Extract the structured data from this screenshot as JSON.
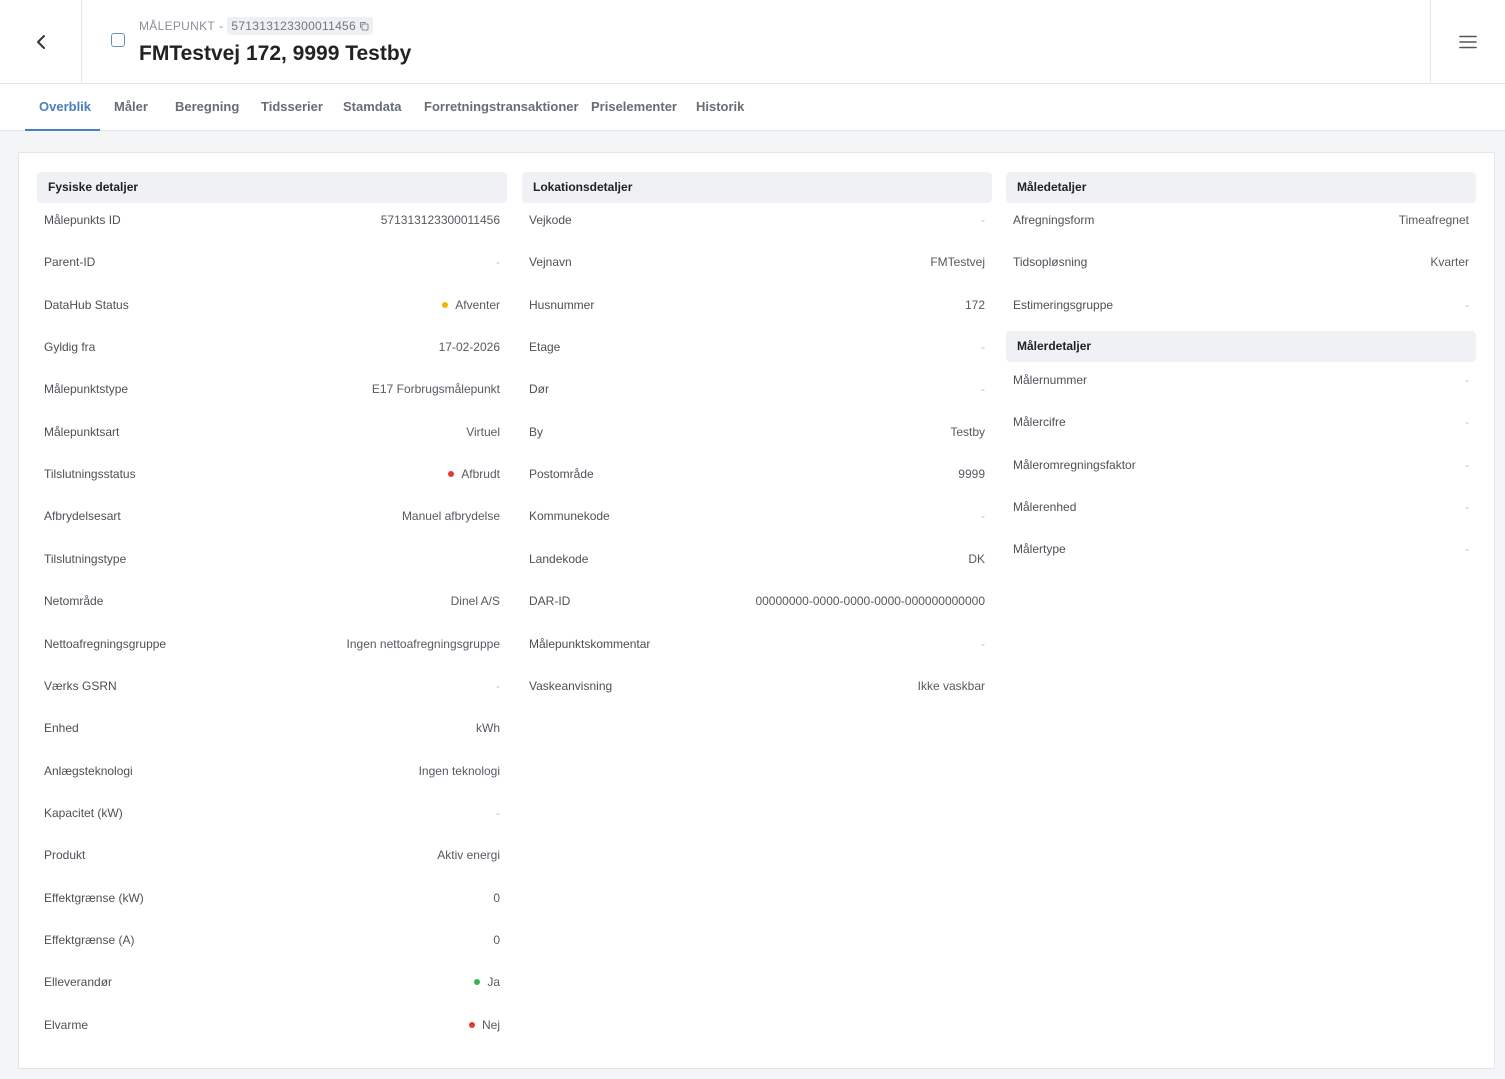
{
  "header": {
    "breadcrumb_label": "MÅLEPUNKT",
    "breadcrumb_sep": "-",
    "id": "571313123300011456",
    "title": "FMTestvej 172, 9999 Testby"
  },
  "tabs": [
    {
      "label": "Overblik",
      "active": true
    },
    {
      "label": "Måler"
    },
    {
      "label": "Beregning"
    },
    {
      "label": "Tidsserier"
    },
    {
      "label": "Stamdata"
    },
    {
      "label": "Forretningstransaktioner"
    },
    {
      "label": "Priselementer"
    },
    {
      "label": "Historik"
    }
  ],
  "colors": {
    "accent": "#4a7fc1",
    "status_yellow": "#f2b600",
    "status_red": "#e53935",
    "status_green": "#2fb84f"
  },
  "fysiske": {
    "title": "Fysiske detaljer",
    "rows": [
      {
        "label": "Målepunkts ID",
        "value": "571313123300011456"
      },
      {
        "label": "Parent-ID",
        "value": "-"
      },
      {
        "label": "DataHub Status",
        "value": "Afventer",
        "dot": "yellow"
      },
      {
        "label": "Gyldig fra",
        "value": "17-02-2026"
      },
      {
        "label": "Målepunktstype",
        "value": "E17 Forbrugsmålepunkt"
      },
      {
        "label": "Målepunktsart",
        "value": "Virtuel"
      },
      {
        "label": "Tilslutningsstatus",
        "value": "Afbrudt",
        "dot": "red"
      },
      {
        "label": "Afbrydelsesart",
        "value": "Manuel afbrydelse"
      },
      {
        "label": "Tilslutningstype",
        "value": ""
      },
      {
        "label": "Netområde",
        "value": "Dinel A/S"
      },
      {
        "label": "Nettoafregningsgruppe",
        "value": "Ingen nettoafregningsgruppe"
      },
      {
        "label": "Værks GSRN",
        "value": "-"
      },
      {
        "label": "Enhed",
        "value": "kWh"
      },
      {
        "label": "Anlægsteknologi",
        "value": "Ingen teknologi"
      },
      {
        "label": "Kapacitet (kW)",
        "value": "-"
      },
      {
        "label": "Produkt",
        "value": "Aktiv energi"
      },
      {
        "label": "Effektgrænse (kW)",
        "value": "0"
      },
      {
        "label": "Effektgrænse (A)",
        "value": "0"
      },
      {
        "label": "Elleverandør",
        "value": "Ja",
        "dot": "green"
      },
      {
        "label": "Elvarme",
        "value": "Nej",
        "dot": "red"
      }
    ]
  },
  "lokation": {
    "title": "Lokationsdetaljer",
    "rows": [
      {
        "label": "Vejkode",
        "value": "-"
      },
      {
        "label": "Vejnavn",
        "value": "FMTestvej"
      },
      {
        "label": "Husnummer",
        "value": "172"
      },
      {
        "label": "Etage",
        "value": "-"
      },
      {
        "label": "Dør",
        "value": "-"
      },
      {
        "label": "By",
        "value": "Testby"
      },
      {
        "label": "Postområde",
        "value": "9999"
      },
      {
        "label": "Kommunekode",
        "value": "-"
      },
      {
        "label": "Landekode",
        "value": "DK"
      },
      {
        "label": "DAR-ID",
        "value": "00000000-0000-0000-0000-000000000000"
      },
      {
        "label": "Målepunktskommentar",
        "value": "-"
      },
      {
        "label": "Vaskeanvisning",
        "value": "Ikke vaskbar"
      }
    ]
  },
  "maaledetaljer": {
    "title": "Måledetaljer",
    "rows": [
      {
        "label": "Afregningsform",
        "value": "Timeafregnet"
      },
      {
        "label": "Tidsopløsning",
        "value": "Kvarter"
      },
      {
        "label": "Estimeringsgruppe",
        "value": "-"
      }
    ]
  },
  "maalerdetaljer": {
    "title": "Målerdetaljer",
    "rows": [
      {
        "label": "Målernummer",
        "value": "-"
      },
      {
        "label": "Målercifre",
        "value": "-"
      },
      {
        "label": "Måleromregningsfaktor",
        "value": "-"
      },
      {
        "label": "Målerenhed",
        "value": "-"
      },
      {
        "label": "Målertype",
        "value": "-"
      }
    ]
  }
}
